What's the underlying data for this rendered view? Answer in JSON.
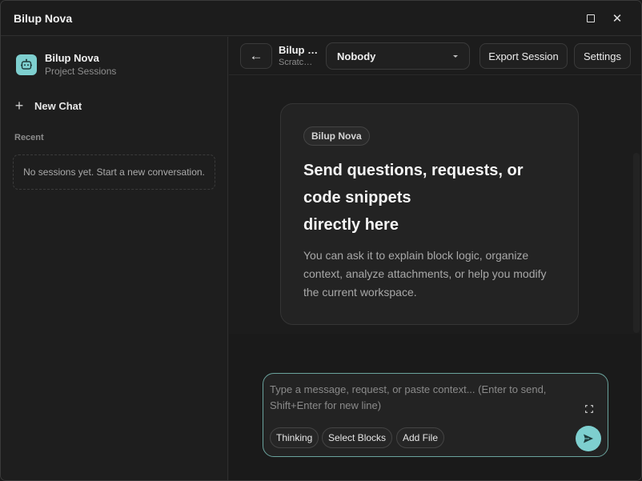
{
  "window": {
    "title": "Bilup Nova"
  },
  "sidebar": {
    "brand_name": "Bilup Nova",
    "brand_subtitle": "Project Sessions",
    "new_chat_label": "New Chat",
    "recent_heading": "Recent",
    "empty_message": "No sessions yet. Start a new conversation."
  },
  "topbar": {
    "back_glyph": "←",
    "session_title": "Bilup Nova",
    "session_subtitle": "Scratch Project",
    "model_value": "Nobody",
    "export_label": "Export Session",
    "settings_label": "Settings"
  },
  "welcome": {
    "badge": "Bilup Nova",
    "headline_line1": "Send questions, requests, or code snippets",
    "headline_line2": "directly here",
    "body": "You can ask it to explain block logic, organize context, analyze attachments, or help you modify the current workspace."
  },
  "composer": {
    "placeholder": "Type a message, request, or paste context... (Enter to send, Shift+Enter for new line)",
    "chips": {
      "thinking": "Thinking",
      "select_blocks": "Select Blocks",
      "add_file": "Add File"
    }
  },
  "colors": {
    "accent": "#7ecfcf",
    "background": "#1c1c1c",
    "border_focus": "#6aa39d"
  },
  "icons": {
    "brand": "robot-icon",
    "maximize": "maximize-icon",
    "close": "close-icon",
    "plus": "plus-icon",
    "back": "arrow-left-icon",
    "caret": "chevron-down-icon",
    "expand": "expand-icon",
    "send": "send-icon"
  }
}
